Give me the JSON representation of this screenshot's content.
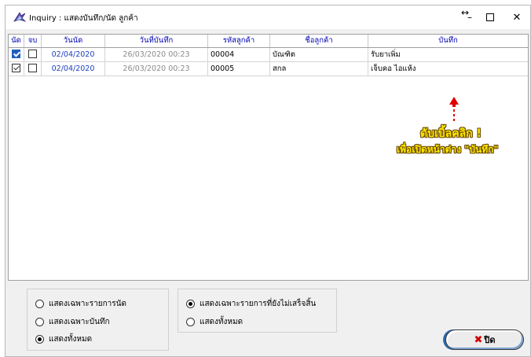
{
  "window": {
    "title": "Inquiry : แสดงบันทึก/นัด ลูกค้า"
  },
  "titlebar": {
    "resize_glyph": "↔",
    "minimize_glyph": "–",
    "maximize_glyph": "☐",
    "close_glyph": "✕"
  },
  "grid": {
    "columns": [
      "นัด",
      "จบ",
      "วันนัด",
      "วันที่บันทึก",
      "รหัสลูกค้า",
      "ชื่อลูกค้า",
      "บันทึก"
    ],
    "rows": [
      {
        "appt": true,
        "done": false,
        "appt_date": "02/04/2020",
        "record_date": "26/03/2020 00:23",
        "customer_code": "00004",
        "customer_name": "บัณฑิต",
        "note": "รับยาเพิ่ม"
      },
      {
        "appt": true,
        "done": false,
        "appt_date": "02/04/2020",
        "record_date": "26/03/2020 00:23",
        "customer_code": "00005",
        "customer_name": "สกล",
        "note": "เจ็บคอ ไอแห้ง"
      }
    ]
  },
  "annotation": {
    "line1": "ดับเบิ้ลคลิก !",
    "line2": "เพื่อเปิดหน้าต่าง \"บันทึก\"",
    "color": "#ffe800",
    "arrow_color": "#e00000"
  },
  "filter_type": {
    "options": [
      "แสดงเฉพาะรายการนัด",
      "แสดงเฉพาะบันทึก",
      "แสดงทั้งหมด"
    ],
    "selected": 2
  },
  "filter_status": {
    "options": [
      "แสดงเฉพาะรายการที่ยังไม่เสร็จสิ้น",
      "แสดงทั้งหมด"
    ],
    "selected": 0
  },
  "buttons": {
    "close_label": "ปิด"
  }
}
